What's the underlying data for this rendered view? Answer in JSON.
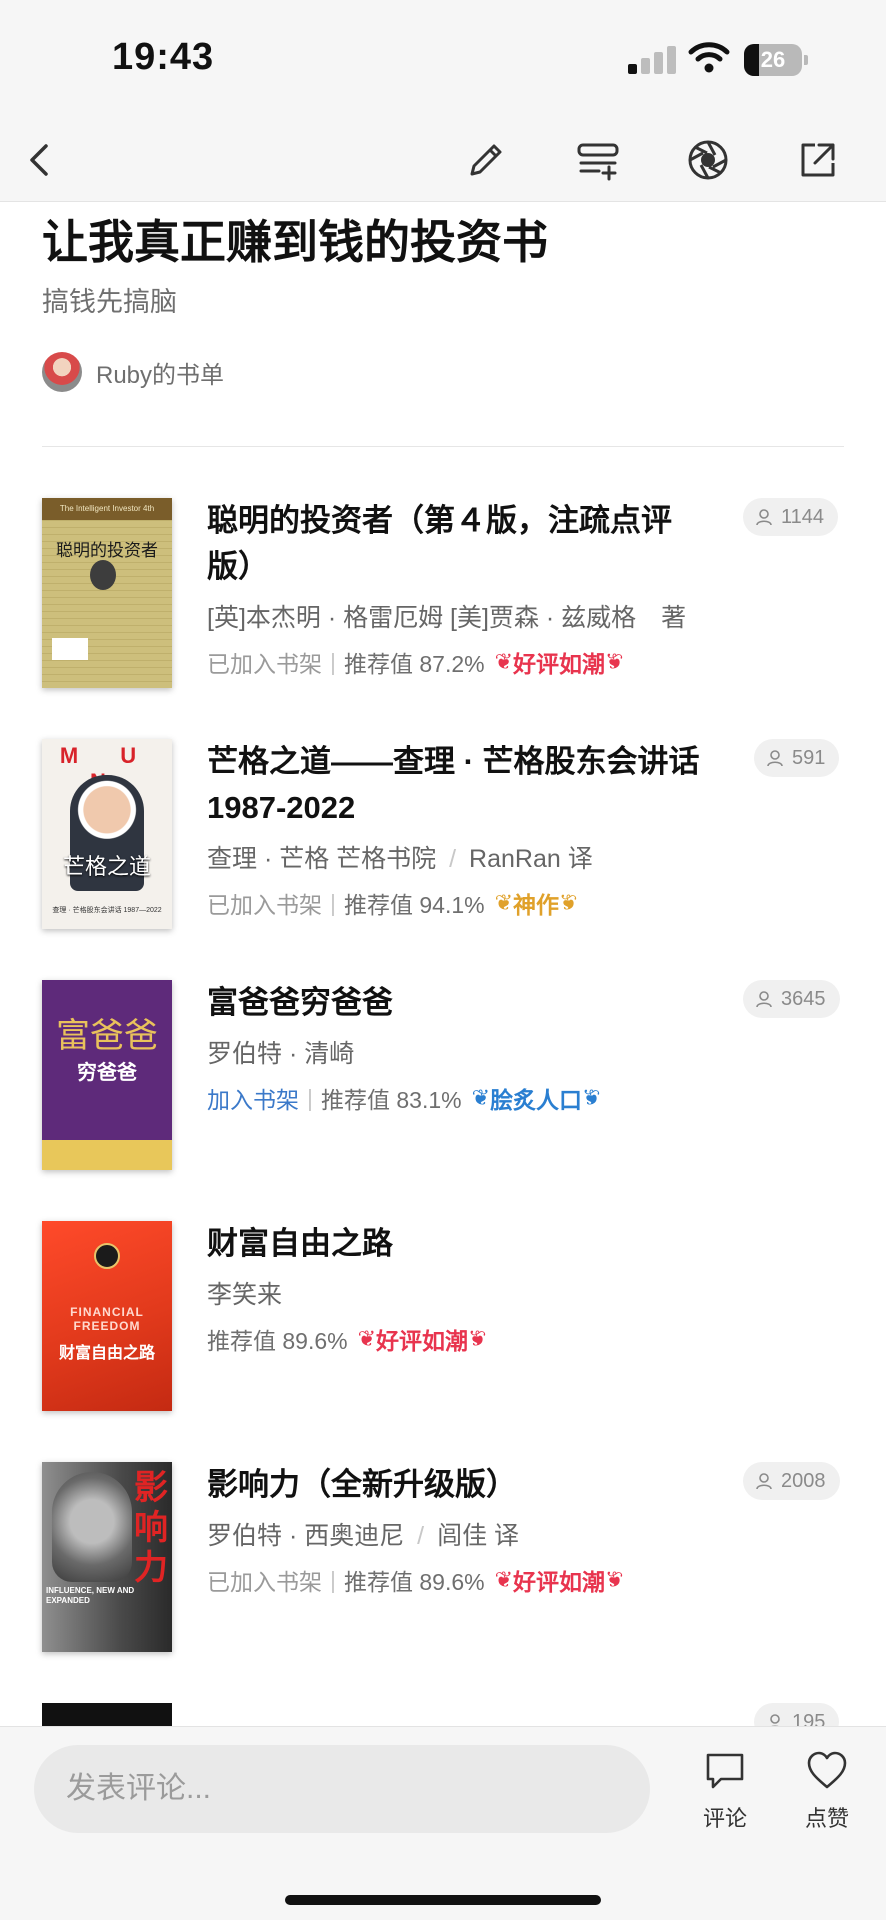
{
  "status_bar": {
    "time": "19:43",
    "battery": "26",
    "battery_level": 0.26
  },
  "nav": {
    "back_icon": "chevron-left-icon",
    "edit_icon": "pencil-icon",
    "add_to_list_icon": "playlist-add-icon",
    "aperture_icon": "aperture-icon",
    "share_icon": "share-external-icon"
  },
  "header": {
    "title": "让我真正赚到钱的投资书",
    "subtitle": "搞钱先搞脑",
    "author": "Ruby的书单"
  },
  "books": [
    {
      "title": "聪明的投资者（第４版，注疏点评版）",
      "author": "[英]本杰明 · 格雷厄姆 [美]贾森 · 兹威格　著",
      "shelf_status": "已加入书架",
      "separator": "|",
      "rec_label": "推荐值 87.2%",
      "badge": "好评如潮",
      "badge_color": "#e8344e",
      "readers": "1144",
      "cover": {
        "top_text": "The Intelligent Investor 4th",
        "main_text": "聪明的投资者"
      }
    },
    {
      "title": "芒格之道——查理 · 芒格股东会讲话1987-2022",
      "author": "查理 · 芒格 芒格书院",
      "translator_sep": "/",
      "translator": "RanRan 译",
      "shelf_status": "已加入书架",
      "separator": "|",
      "rec_label": "推荐值 94.1%",
      "badge": "神作",
      "badge_color": "#e0a12a",
      "readers": "591",
      "cover": {
        "top_text": "M U N",
        "main_text": "芒格之道",
        "bottom_text": "查理 · 芒格股东会讲话 1987—2022"
      }
    },
    {
      "title": "富爸爸穷爸爸",
      "author": "罗伯特 · 清崎",
      "shelf_status": "加入书架",
      "separator": "|",
      "rec_label": "推荐值 83.1%",
      "badge": "脍炙人口",
      "badge_color": "#2a7fd1",
      "readers": "3645",
      "cover": {
        "main_text": "富爸爸",
        "sub_text": "穷爸爸"
      }
    },
    {
      "title": "财富自由之路",
      "author": "李笑来",
      "rec_label": "推荐值 89.6%",
      "badge": "好评如潮",
      "badge_color": "#e8344e",
      "cover": {
        "en_text": "FINANCIAL FREEDOM",
        "main_text": "财富自由之路"
      }
    },
    {
      "title": "影响力（全新升级版）",
      "author": "罗伯特 · 西奥迪尼",
      "translator_sep": "/",
      "translator": "闾佳 译",
      "shelf_status": "已加入书架",
      "separator": "|",
      "rec_label": "推荐值 89.6%",
      "badge": "好评如潮",
      "badge_color": "#e8344e",
      "readers": "2008",
      "cover": {
        "main_text": "影响力",
        "en_text": "INFLUENCE, NEW AND EXPANDED"
      }
    },
    {
      "readers": "195"
    }
  ],
  "bottom_bar": {
    "comment_placeholder": "发表评论...",
    "comment_label": "评论",
    "like_label": "点赞"
  }
}
